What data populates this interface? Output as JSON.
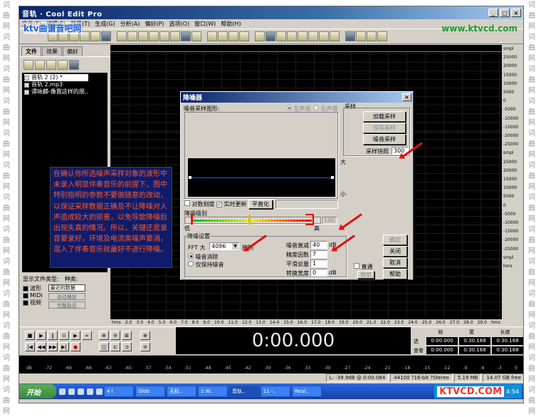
{
  "side_watermark": {
    "chars": [
      "词",
      "曲",
      "网",
      "词",
      "曲",
      "网",
      "词",
      "曲",
      "网",
      "词",
      "曲",
      "网",
      "词",
      "曲",
      "网",
      "词",
      "曲",
      "网",
      "词",
      "曲",
      "网",
      "词",
      "曲",
      "网",
      "词",
      "曲",
      "网",
      "词",
      "曲",
      "网",
      "词",
      "曲",
      "网",
      "词",
      "曲",
      "网",
      "词",
      "曲",
      "网"
    ]
  },
  "window": {
    "title": "音轨 · Cool Edit Pro",
    "brand_left": "ktv曲谱音吧网",
    "brand_right": "www.ktvcd.com"
  },
  "menu": [
    "文件(F)",
    "编辑(E)",
    "效果(T)",
    "生成(G)",
    "分析(A)",
    "偏好(P)",
    "选项(O)",
    "窗口(W)",
    "帮助(H)"
  ],
  "left_panel": {
    "tabs": [
      "文件",
      "效果",
      "偏好"
    ],
    "files": [
      "音轨 2 (2) *",
      "音轨 2.mp3",
      "谭咏麟-像我这样的朋.."
    ],
    "file_type_label": "显示文件类型:",
    "sort_label": "种类:",
    "types": [
      "波形",
      "MIDI",
      "视频"
    ],
    "sort_value": "最近的数据",
    "btn_autoplay": "自动播放",
    "btn_fullpath": "完整路径"
  },
  "wave": {
    "ruler_bottom": [
      "hms",
      "2.0",
      "3.0",
      "4.0",
      "5.0",
      "6.0",
      "7.0",
      "8.0",
      "9.0",
      "10.0",
      "11.0",
      "12.0",
      "13.0",
      "14.0",
      "15.0",
      "16.0",
      "17.0",
      "18.0",
      "19.0",
      "20.0",
      "21.0",
      "22.0",
      "23.0",
      "24.0",
      "25.0",
      "26.0",
      "27.0",
      "28.0",
      "29.0",
      "hms"
    ],
    "scale": [
      "smpl",
      "25000",
      "20000",
      "15000",
      "10000",
      "5000",
      "0",
      "-5000",
      "-10000",
      "-15000",
      "-20000",
      "-25000",
      "smpl",
      "25000",
      "20000",
      "15000",
      "10000",
      "5000",
      "0",
      "-5000",
      "-10000",
      "-15000",
      "-20000",
      "-25000",
      "smpl",
      "hms"
    ]
  },
  "transport": {
    "time": "0:00.000",
    "headers": [
      "始",
      "尾",
      "长度"
    ],
    "rows": [
      {
        "label": "选",
        "start": "0:00.000",
        "end": "0:30.168",
        "len": "0:30.168"
      },
      {
        "label": "查看",
        "start": "0:00.000",
        "end": "0:30.168",
        "len": "0:30.168"
      }
    ]
  },
  "level_scale": [
    "dB",
    "-72",
    "-69",
    "-66",
    "-63",
    "-60",
    "-57",
    "-54",
    "-51",
    "-48",
    "-45",
    "-42",
    "-39",
    "-36",
    "-33",
    "-30",
    "-27",
    "-24",
    "-21",
    "-18",
    "-15",
    "-12",
    "-9",
    "-6",
    "-3",
    "0"
  ],
  "status": [
    "L: -39.9dB @  0:00.084",
    "44100 ?16-bit ?Stereo",
    "5.19 MB",
    "14.07 GB free"
  ],
  "taskbar": {
    "start": "开始",
    "tasks": [
      "4 I",
      "Glob",
      "无标..",
      "2 W..",
      "音轨..",
      "11 -..",
      "Real.."
    ],
    "brand": "KTVCD.COM",
    "clock": "4:54"
  },
  "annotation": {
    "text": "在确认你所选噪声采样对象的波形中未录入明显伴奏音乐的前提下，图中特别指明的参数不要做随意的改动，以保证采样数据正确及不让降噪对人声造成较大的损害，以免导致降噪后出现失真的情况。所以，关键还是录音要录好，环境及电流类噪声要消，混入了伴奏音乐就最好不进行降噪。"
  },
  "dialog": {
    "title": "降噪器",
    "shape_label": "噪音采样图形:",
    "ch_left": "左声道",
    "ch_right": "右声道",
    "sample_group": "采样",
    "btn_load": "加载采样",
    "btn_save": "保存采样",
    "btn_get": "噪音采样",
    "snapshots_label": "采样快照",
    "snapshots_value": "300",
    "big": "大",
    "small": "小",
    "log_label": "对数刻度",
    "live_label": "实时更新",
    "flat_btn": "平直化",
    "level_label": "降噪级别",
    "low": "低",
    "high": "高",
    "level_value": "100",
    "settings_group": "降噪设置",
    "fft_label": "FFT 大",
    "fft_value": "4096",
    "control_label": "控制",
    "remove_label": "噪音消除",
    "keep_label": "仅保持噪音",
    "reduce_label": "噪音衰减",
    "reduce_value": "40",
    "reduce_unit": "dB",
    "precision_label": "精度因数",
    "precision_value": "7",
    "smooth_label": "平滑总量",
    "smooth_value": "1",
    "trans_label": "转换宽度",
    "trans_value": "0",
    "trans_unit": "dB",
    "bypass_label": "直通",
    "btn_ok": "确定",
    "btn_close": "关闭",
    "btn_cancel": "取消",
    "btn_help": "帮助",
    "btn_preview": "预览",
    "noise_level_pct": 100
  }
}
